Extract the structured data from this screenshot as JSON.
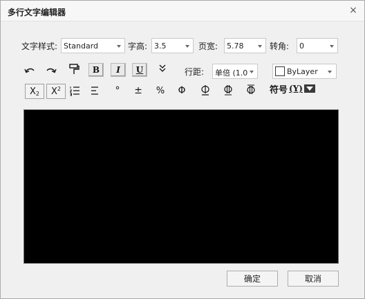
{
  "dialog": {
    "title": "多行文字编辑器",
    "close_glyph": "×"
  },
  "row1": {
    "style_label": "文字样式:",
    "style_value": "Standard",
    "height_label": "字高:",
    "height_value": "3.5",
    "width_label": "页宽:",
    "width_value": "5.78",
    "angle_label": "转角:",
    "angle_value": "0"
  },
  "toolbar": {
    "bold_glyph": "B",
    "italic_glyph": "I",
    "underline_glyph": "U",
    "expand_glyph": "»",
    "line_spacing_label": "行距:",
    "line_spacing_value": "单倍 (1.0",
    "color_value": "ByLayer",
    "subscript": {
      "base": "X",
      "sub": "2"
    },
    "superscript": {
      "base": "X",
      "sup": "2"
    },
    "degree_glyph": "°",
    "plusminus_glyph": "±",
    "percent_glyph": "%",
    "phi_glyph": "Φ",
    "symbol_label": "符号(Y)",
    "symbol_char": "符号",
    "symbol_key": "(Y)"
  },
  "buttons": {
    "ok": "确定",
    "cancel": "取消"
  }
}
